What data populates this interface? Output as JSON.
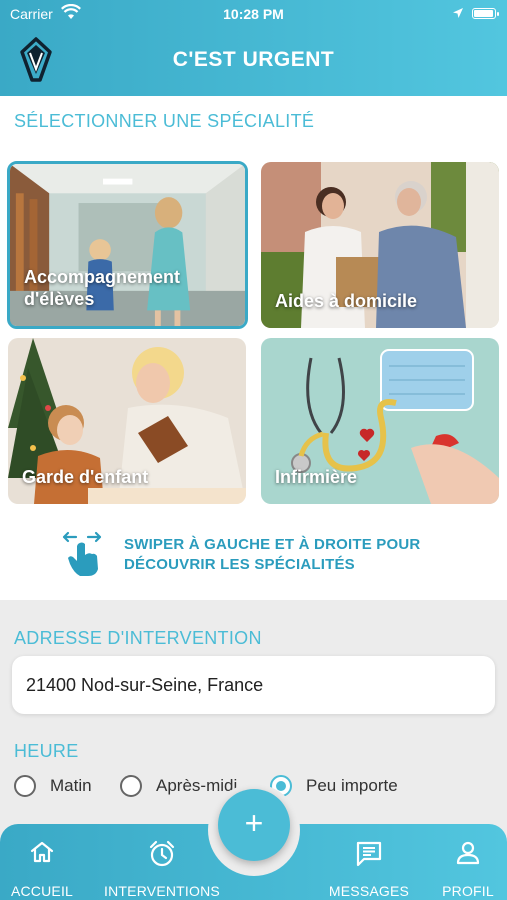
{
  "status_bar": {
    "carrier": "Carrier",
    "time": "10:28 PM"
  },
  "header": {
    "title": "C'EST URGENT",
    "logo_icon": "app-logo-icon"
  },
  "specialty": {
    "heading": "SÉLECTIONNER UNE SPÉCIALITÉ",
    "cards": [
      {
        "label": "Accompagnement d'élèves",
        "selected": true
      },
      {
        "label": "Aides à domicile",
        "selected": false
      },
      {
        "label": "Garde d'enfant",
        "selected": false
      },
      {
        "label": "Infirmière",
        "selected": false
      }
    ],
    "swipe_hint_line1": "SWIPER À GAUCHE ET À DROITE POUR",
    "swipe_hint_line2": "DÉCOUVRIR LES SPÉCIALITÉS"
  },
  "address": {
    "heading": "ADRESSE D'INTERVENTION",
    "value": "21400 Nod-sur-Seine, France"
  },
  "time_pref": {
    "heading": "HEURE",
    "options": [
      {
        "label": "Matin",
        "checked": false
      },
      {
        "label": "Après-midi",
        "checked": false
      },
      {
        "label": "Peu importe",
        "checked": true
      }
    ]
  },
  "tabbar": {
    "items": [
      {
        "label": "ACCUEIL",
        "icon": "home-icon"
      },
      {
        "label": "INTERVENTIONS",
        "icon": "alarm-clock-icon"
      },
      {
        "label": "MESSAGES",
        "icon": "message-icon"
      },
      {
        "label": "PROFIL",
        "icon": "user-icon"
      }
    ],
    "fab_symbol": "+"
  },
  "colors": {
    "accent": "#4bbcd6",
    "header_start": "#3aa9c6",
    "header_end": "#52c6df",
    "swipe_text": "#2b9cbd"
  }
}
